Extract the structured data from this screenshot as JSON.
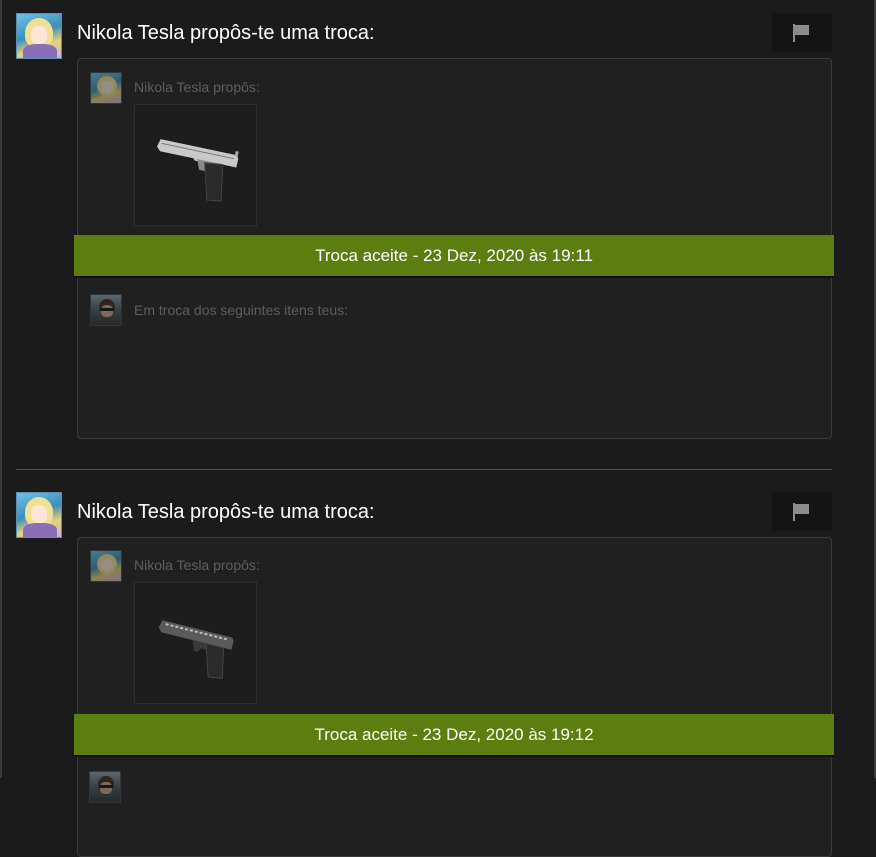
{
  "offers": [
    {
      "title": "Nikola Tesla propôs-te uma troca:",
      "proposed_label": "Nikola Tesla propôs:",
      "status": "Troca aceite - 23 Dez, 2020 às 19:11",
      "return_label": "Em troca dos seguintes itens teus:",
      "item_icon": "desert-eagle-pistol-icon"
    },
    {
      "title": "Nikola Tesla propôs-te uma troca:",
      "proposed_label": "Nikola Tesla propôs:",
      "status": "Troca aceite - 23 Dez, 2020 às 19:12",
      "item_icon": "glock-pistol-icon"
    }
  ],
  "icons": {
    "report": "flag-icon",
    "avatar_partner": "nikola-tesla-avatar",
    "avatar_user": "user-avatar"
  },
  "colors": {
    "background": "#1b1b1b",
    "card": "#202020",
    "status_bar": "#5c7e10",
    "title_text": "#ffffff",
    "muted_text": "#5e5e5e"
  }
}
